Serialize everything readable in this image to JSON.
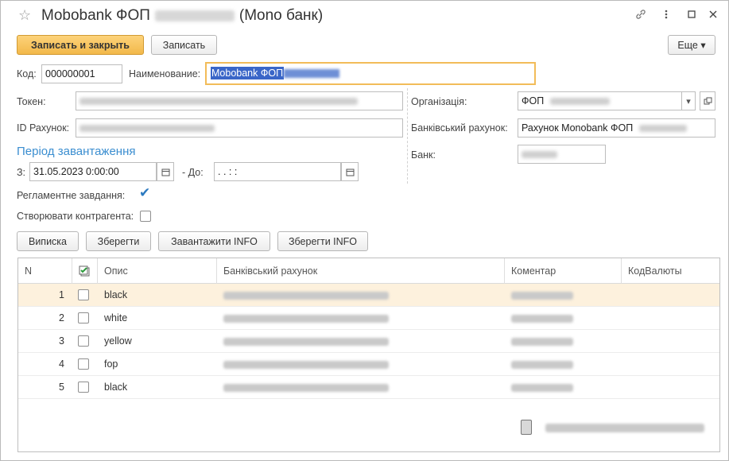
{
  "window": {
    "title_prefix": "Mobobank ФОП",
    "title_suffix": "(Mono банк)",
    "link_icon": "link-icon",
    "more_icon": "more-vertical-icon",
    "maximize_icon": "maximize-icon",
    "close_icon": "close-icon"
  },
  "toolbar": {
    "save_close_label": "Записать и закрыть",
    "save_label": "Записать",
    "more_label": "Еще ▾"
  },
  "form": {
    "code_label": "Код:",
    "code_value": "000000001",
    "name_label": "Наименование:",
    "name_value": "Mobobank ФОП",
    "token_label": "Токен:",
    "account_id_label": "ID Рахунок:",
    "organization_label": "Організація:",
    "organization_value": "ФОП",
    "bank_account_label": "Банківський рахунок:",
    "bank_account_value": "Рахунок Monobank ФОП",
    "bank_label": "Банк:",
    "period_title": "Період завантаження",
    "from_label": "З:",
    "from_value": "31.05.2023  0:00:00",
    "to_label": "- До:",
    "to_value": " .  .       :  :",
    "scheduled_label": "Регламентне завдання:",
    "scheduled_checked": true,
    "create_contractor_label": "Створювати контрагента:",
    "create_contractor_checked": false
  },
  "actions": {
    "statement_label": "Виписка",
    "save_label": "Зберегти",
    "load_info_label": "Завантажити  INFO",
    "save_info_label": "Зберегти INFO"
  },
  "table": {
    "columns": [
      "N",
      "",
      "Опис",
      "Банківський рахунок",
      "Коментар",
      "КодВалюты"
    ],
    "rows": [
      {
        "n": "1",
        "desc": "black"
      },
      {
        "n": "2",
        "desc": "white"
      },
      {
        "n": "3",
        "desc": "yellow"
      },
      {
        "n": "4",
        "desc": "fop"
      },
      {
        "n": "5",
        "desc": "black"
      }
    ]
  }
}
